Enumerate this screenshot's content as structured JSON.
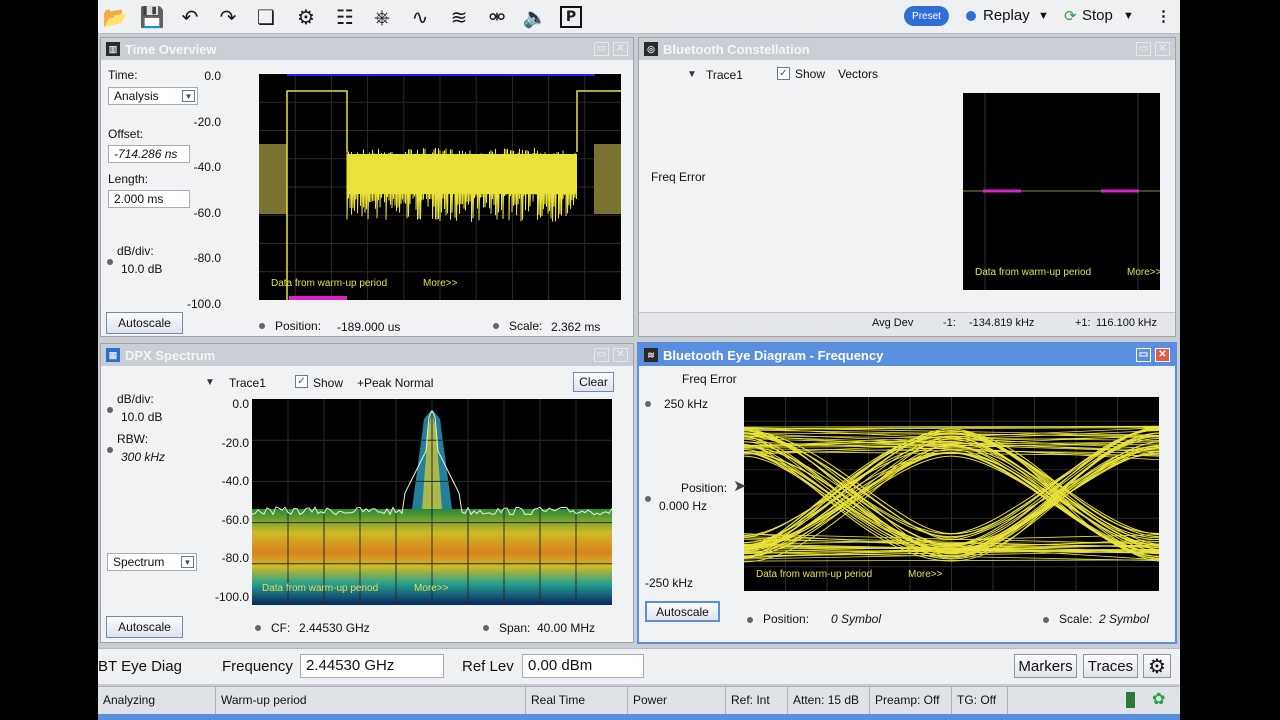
{
  "toolbar": {
    "icons": [
      "folder-open-icon",
      "save-icon",
      "undo-icon",
      "redo-icon",
      "windows-icon",
      "settings-gear-icon",
      "tag-icon",
      "trigger-icon",
      "waveform-icon",
      "spectrogram-icon",
      "probe-icon",
      "speaker-icon",
      "p-icon"
    ],
    "preset_label": "Preset",
    "replay_label": "Replay",
    "stop_label": "Stop",
    "accent": "#2f6fd6"
  },
  "time_overview": {
    "title": "Time Overview",
    "time_label": "Time:",
    "time_value": "Analysis",
    "offset_label": "Offset:",
    "offset_value": "-714.286 ns",
    "length_label": "Length:",
    "length_value": "2.000 ms",
    "dbdiv_label": "dB/div:",
    "dbdiv_value": "10.0 dB",
    "y_ticks": [
      "0.0",
      "-20.0",
      "-40.0",
      "-60.0",
      "-80.0",
      "-100.0"
    ],
    "warmup_text": "Data from warm-up period",
    "more_text": "More>>",
    "autoscale_label": "Autoscale",
    "position_label": "Position:",
    "position_value": "-189.000 us",
    "scale_label": "Scale:",
    "scale_value": "2.362 ms"
  },
  "constellation": {
    "title": "Bluetooth Constellation",
    "trace_label": "Trace1",
    "show_label": "Show",
    "vectors_label": "Vectors",
    "freq_error_label": "Freq Error",
    "warmup_text": "Data from warm-up period",
    "more_text": "More>>",
    "avg_dev_label": "Avg Dev",
    "minus1_label": "-1:",
    "minus1_value": "-134.819 kHz",
    "plus1_label": "+1:",
    "plus1_value": "116.100 kHz"
  },
  "dpx": {
    "title": "DPX Spectrum",
    "trace_label": "Trace1",
    "show_label": "Show",
    "detector_label": "+Peak Normal",
    "clear_label": "Clear",
    "dbdiv_label": "dB/div:",
    "dbdiv_value": "10.0 dB",
    "rbw_label": "RBW:",
    "rbw_value": "300 kHz",
    "y_ticks": [
      "0.0",
      "-20.0",
      "-40.0",
      "-60.0",
      "-80.0",
      "-100.0"
    ],
    "mode_value": "Spectrum",
    "warmup_text": "Data from warm-up period",
    "more_text": "More>>",
    "autoscale_label": "Autoscale",
    "cf_label": "CF:",
    "cf_value": "2.44530 GHz",
    "span_label": "Span:",
    "span_value": "40.00 MHz"
  },
  "eye": {
    "title": "Bluetooth Eye Diagram - Frequency",
    "freq_error_label": "Freq Error",
    "top_value": "250 kHz",
    "position_label": "Position:",
    "position_value": "0.000 Hz",
    "bottom_value": "-250 kHz",
    "warmup_text": "Data from warm-up period",
    "more_text": "More>>",
    "autoscale_label": "Autoscale",
    "hpos_label": "Position:",
    "hpos_value": "0 Symbol",
    "scale_label": "Scale:",
    "scale_value": "2 Symbol"
  },
  "bottom": {
    "measurement": "BT Eye Diag",
    "frequency_label": "Frequency",
    "frequency_value": "2.44530 GHz",
    "reflev_label": "Ref Lev",
    "reflev_value": "0.00 dBm",
    "markers_label": "Markers",
    "traces_label": "Traces"
  },
  "status": {
    "state": "Analyzing",
    "message": "Warm-up period",
    "mode": "Real Time",
    "trigger": "Power",
    "ref": "Ref: Int",
    "atten": "Atten: 15 dB",
    "preamp": "Preamp: Off",
    "tg": "TG: Off"
  },
  "colors": {
    "trace_yellow": "#e8e23a",
    "marker_magenta": "#e020c8",
    "panel_active": "#5a8ede"
  }
}
